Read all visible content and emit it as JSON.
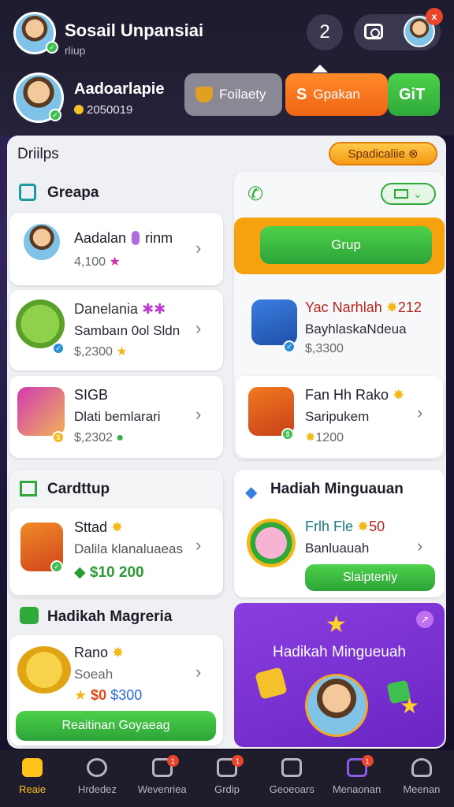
{
  "header": {
    "title": "Sosail Unpansiai",
    "subtitle": "rliup",
    "count": "2",
    "close_label": "x",
    "user": {
      "name": "Aadoarlapie",
      "coins": "2050019"
    },
    "buttons": {
      "gray": "Foilaety",
      "orange": "Gpakan",
      "green": "GiT"
    }
  },
  "panel": {
    "title": "Driilps",
    "pill": "Spadicaliie"
  },
  "groups": {
    "title": "Greapa",
    "items": [
      {
        "title": "Aadalan",
        "title_extra": "rinm",
        "value": "4,100"
      },
      {
        "title": "Danelania",
        "subtitle": "Sambaın 0ol Sldn",
        "value": "$,2300"
      },
      {
        "title": "SIGB",
        "subtitle": "Dlati bemlarari",
        "value": "$,2302"
      }
    ]
  },
  "right_top": {
    "button": "Grup",
    "items": [
      {
        "title": "Yac Narhlah",
        "title_value": "212",
        "subtitle": "BayhlaskaNdeua",
        "value": "$,3300"
      },
      {
        "title": "Fan Hh Rako",
        "subtitle": "Saripukem",
        "value": "1200"
      }
    ]
  },
  "cardtup": {
    "title": "Cardttup",
    "item": {
      "title": "Sttad",
      "subtitle": "Dalila klanaluaeas",
      "value": "$10 200"
    }
  },
  "hadiah_left": {
    "title": "Hadikah Magreria",
    "item": {
      "title": "Rano",
      "subtitle": "Soeah",
      "value_a": "$0",
      "value_b": "$300"
    },
    "button": "Reaitinan  Goyaeag"
  },
  "hadiah_right": {
    "title": "Hadiah Minguauan",
    "item": {
      "title": "Frlh Fle",
      "title_value": "50",
      "subtitle": "Banluauah"
    },
    "button": "Slaipteniy"
  },
  "promo": {
    "title": "Hadikah Mingueuah"
  },
  "nav": [
    {
      "label": "Reaie",
      "icon": "home-icon",
      "active": true
    },
    {
      "label": "Hrdedez",
      "icon": "search-icon",
      "badge": ""
    },
    {
      "label": "Wevenriea",
      "icon": "chat-icon",
      "badge": "1"
    },
    {
      "label": "Grdip",
      "icon": "group-icon",
      "badge": "1"
    },
    {
      "label": "Geoeoars",
      "icon": "discover-icon",
      "badge": ""
    },
    {
      "label": "Menaonan",
      "icon": "messages-icon",
      "badge": "1"
    },
    {
      "label": "Meenan",
      "icon": "profile-icon",
      "badge": ""
    }
  ],
  "colors": {
    "accent_orange": "#f06414",
    "accent_green": "#2ea93a",
    "accent_purple": "#7a32d6",
    "nav_active": "#ffc21a"
  }
}
